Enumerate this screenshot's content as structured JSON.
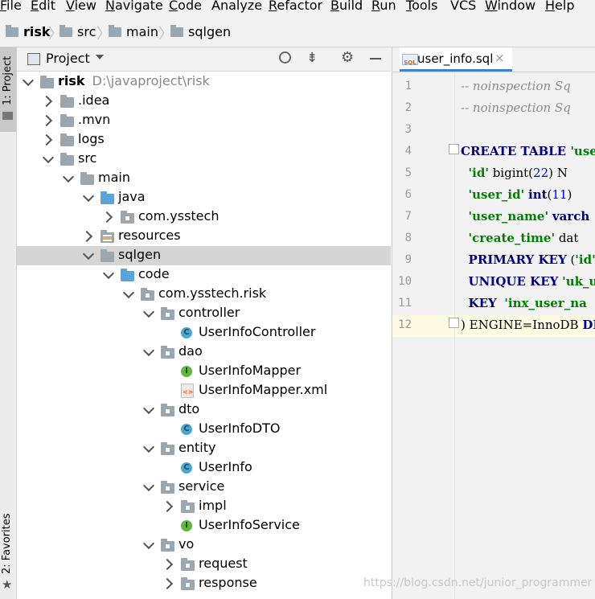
{
  "menu": [
    {
      "label": "File",
      "u": "F",
      "rest": "ile"
    },
    {
      "label": "Edit",
      "u": "E",
      "rest": "dit"
    },
    {
      "label": "View",
      "u": "V",
      "rest": "iew"
    },
    {
      "label": "Navigate",
      "u": "N",
      "rest": "avigate"
    },
    {
      "label": "Code",
      "u": "C",
      "rest": "ode"
    },
    {
      "label": "Analyze",
      "u": "",
      "rest": "Analyze"
    },
    {
      "label": "Refactor",
      "u": "R",
      "rest": "efactor"
    },
    {
      "label": "Build",
      "u": "B",
      "rest": "uild"
    },
    {
      "label": "Run",
      "u": "R",
      "rest": "un"
    },
    {
      "label": "Tools",
      "u": "T",
      "rest": "ools"
    },
    {
      "label": "VCS",
      "u": "",
      "rest": "VCS"
    },
    {
      "label": "Window",
      "u": "W",
      "rest": "indow"
    },
    {
      "label": "Help",
      "u": "H",
      "rest": "elp"
    }
  ],
  "breadcrumb": [
    "risk",
    "src",
    "main",
    "sqlgen"
  ],
  "side": {
    "project_tab": "1: Project",
    "favorites_tab": "2: Favorites"
  },
  "project_panel": {
    "title": "Project"
  },
  "tree": [
    {
      "label": "risk",
      "path": "D:\\javaproject\\risk",
      "bold": true,
      "icon": "folder",
      "chev": "down"
    },
    {
      "label": ".idea",
      "icon": "folder",
      "chev": "right"
    },
    {
      "label": ".mvn",
      "icon": "folder",
      "chev": "right"
    },
    {
      "label": "logs",
      "icon": "folder",
      "chev": "right"
    },
    {
      "label": "src",
      "icon": "folder",
      "chev": "down"
    },
    {
      "label": "main",
      "icon": "folder",
      "chev": "down"
    },
    {
      "label": "java",
      "icon": "folder-blue",
      "chev": "down"
    },
    {
      "label": "com.ysstech",
      "icon": "package",
      "chev": "right"
    },
    {
      "label": "resources",
      "icon": "resources",
      "chev": "right"
    },
    {
      "label": "sqlgen",
      "icon": "folder",
      "chev": "down",
      "selected": true
    },
    {
      "label": "code",
      "icon": "folder-blue",
      "chev": "down"
    },
    {
      "label": "com.ysstech.risk",
      "icon": "package",
      "chev": "down"
    },
    {
      "label": "controller",
      "icon": "package",
      "chev": "down"
    },
    {
      "label": "UserInfoController",
      "icon": "class",
      "chev": ""
    },
    {
      "label": "dao",
      "icon": "package",
      "chev": "down"
    },
    {
      "label": "UserInfoMapper",
      "icon": "interface",
      "chev": ""
    },
    {
      "label": "UserInfoMapper.xml",
      "icon": "xml",
      "chev": ""
    },
    {
      "label": "dto",
      "icon": "package",
      "chev": "down"
    },
    {
      "label": "UserInfoDTO",
      "icon": "class",
      "chev": ""
    },
    {
      "label": "entity",
      "icon": "package",
      "chev": "down"
    },
    {
      "label": "UserInfo",
      "icon": "class",
      "chev": ""
    },
    {
      "label": "service",
      "icon": "package",
      "chev": "down"
    },
    {
      "label": "impl",
      "icon": "package",
      "chev": "right"
    },
    {
      "label": "UserInfoService",
      "icon": "interface",
      "chev": ""
    },
    {
      "label": "vo",
      "icon": "package",
      "chev": "down"
    },
    {
      "label": "request",
      "icon": "package",
      "chev": "right"
    },
    {
      "label": "response",
      "icon": "package",
      "chev": "right"
    }
  ],
  "editor": {
    "tab_label": "user_info.sql",
    "tab_icon_text": "SQL",
    "lines": [
      {
        "n": "1",
        "parts": [
          {
            "c": "cm",
            "t": "-- noinspection Sq"
          }
        ]
      },
      {
        "n": "2",
        "parts": [
          {
            "c": "cm",
            "t": "-- noinspection Sq"
          }
        ]
      },
      {
        "n": "3",
        "parts": []
      },
      {
        "n": "4",
        "parts": [
          {
            "c": "kw",
            "t": "CREATE TABLE "
          },
          {
            "c": "str",
            "t": "'user_"
          }
        ]
      },
      {
        "n": "5",
        "parts": [
          {
            "c": "",
            "t": "  "
          },
          {
            "c": "str",
            "t": "'id'"
          },
          {
            "c": "",
            "t": " bigint("
          },
          {
            "c": "num",
            "t": "22"
          },
          {
            "c": "",
            "t": ") N"
          }
        ]
      },
      {
        "n": "6",
        "parts": [
          {
            "c": "",
            "t": "  "
          },
          {
            "c": "str",
            "t": "'user_id'"
          },
          {
            "c": "",
            "t": " "
          },
          {
            "c": "kw",
            "t": "int"
          },
          {
            "c": "",
            "t": "("
          },
          {
            "c": "num",
            "t": "11"
          },
          {
            "c": "",
            "t": ")"
          }
        ]
      },
      {
        "n": "7",
        "parts": [
          {
            "c": "",
            "t": "  "
          },
          {
            "c": "str",
            "t": "'user_name'"
          },
          {
            "c": "",
            "t": " "
          },
          {
            "c": "kw",
            "t": "varch"
          }
        ]
      },
      {
        "n": "8",
        "parts": [
          {
            "c": "",
            "t": "  "
          },
          {
            "c": "str",
            "t": "'create_time'"
          },
          {
            "c": "",
            "t": " dat"
          }
        ]
      },
      {
        "n": "9",
        "parts": [
          {
            "c": "",
            "t": "  "
          },
          {
            "c": "kw",
            "t": "PRIMARY KEY"
          },
          {
            "c": "",
            "t": " ("
          },
          {
            "c": "str",
            "t": "'id'"
          }
        ]
      },
      {
        "n": "10",
        "parts": [
          {
            "c": "",
            "t": "  "
          },
          {
            "c": "kw",
            "t": "UNIQUE KEY"
          },
          {
            "c": "",
            "t": " "
          },
          {
            "c": "str",
            "t": "'uk_us"
          }
        ]
      },
      {
        "n": "11",
        "parts": [
          {
            "c": "",
            "t": "  "
          },
          {
            "c": "kw",
            "t": "KEY"
          },
          {
            "c": "",
            "t": "  "
          },
          {
            "c": "str",
            "t": "'inx_user_na"
          }
        ]
      },
      {
        "n": "12",
        "parts": [
          {
            "c": "",
            "t": ") ENGINE=InnoDB "
          },
          {
            "c": "kw",
            "t": "DEF"
          }
        ]
      }
    ]
  },
  "watermark": "https://blog.csdn.net/junior_programmer"
}
